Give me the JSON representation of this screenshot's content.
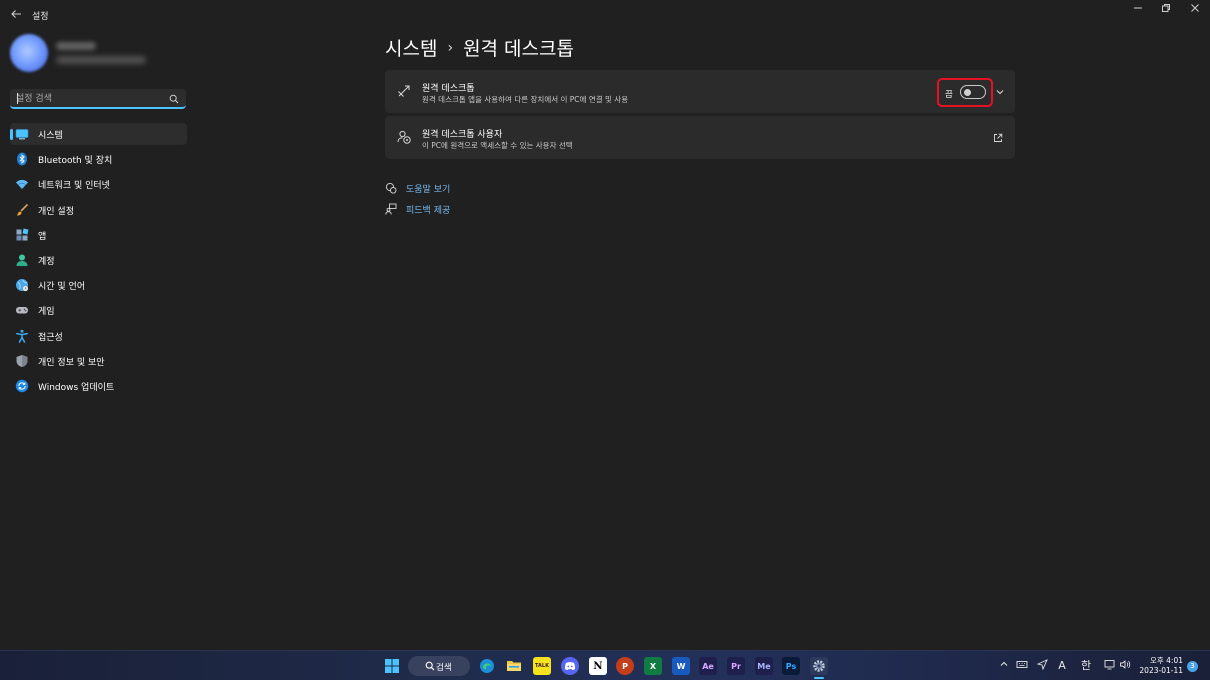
{
  "window": {
    "title": "설정",
    "controls": {
      "minimize": "—",
      "maximize": "❐",
      "close": "✕"
    }
  },
  "sidebar": {
    "search_placeholder": "설정 검색",
    "items": [
      {
        "label": "시스템",
        "icon": "system-icon",
        "active": true
      },
      {
        "label": "Bluetooth 및 장치",
        "icon": "bluetooth-icon"
      },
      {
        "label": "네트워크 및 인터넷",
        "icon": "network-icon"
      },
      {
        "label": "개인 설정",
        "icon": "personalization-brush-icon"
      },
      {
        "label": "앱",
        "icon": "apps-icon"
      },
      {
        "label": "계정",
        "icon": "account-icon"
      },
      {
        "label": "시간 및 언어",
        "icon": "time-language-icon"
      },
      {
        "label": "게임",
        "icon": "gaming-icon"
      },
      {
        "label": "접근성",
        "icon": "accessibility-icon"
      },
      {
        "label": "개인 정보 및 보안",
        "icon": "privacy-shield-icon"
      },
      {
        "label": "Windows 업데이트",
        "icon": "windows-update-icon"
      }
    ]
  },
  "main": {
    "breadcrumb": {
      "parent": "시스템",
      "separator": "›",
      "current": "원격 데스크톱"
    },
    "cards": [
      {
        "title": "원격 데스크톱",
        "subtitle": "원격 데스크톱 앱을 사용하여 다른 장치에서 이 PC에 연결 및 사용",
        "toggle_label": "끔",
        "toggle_on": false,
        "icon": "remote-desktop-icon"
      },
      {
        "title": "원격 데스크톱 사용자",
        "subtitle": "이 PC에 원격으로 액세스할 수 있는 사용자 선택",
        "icon": "remote-users-icon"
      }
    ],
    "help_links": [
      {
        "label": "도움말 보기",
        "icon": "help-icon"
      },
      {
        "label": "피드백 제공",
        "icon": "feedback-icon"
      }
    ]
  },
  "taskbar": {
    "search_label": "검색",
    "apps": [
      {
        "name": "Microsoft Edge",
        "icon": "edge-icon",
        "color": "#1d8fd6"
      },
      {
        "name": "File Explorer",
        "icon": "folder-icon",
        "color": "#f2c744"
      },
      {
        "name": "KakaoTalk",
        "icon": "kakaotalk-icon",
        "text": "TALK",
        "color": "#f7e31b"
      },
      {
        "name": "Discord",
        "icon": "discord-icon",
        "color": "#5865f2"
      },
      {
        "name": "Notion",
        "icon": "notion-icon",
        "text": "N",
        "color": "#ffffff"
      },
      {
        "name": "PowerPoint",
        "icon": "powerpoint-icon",
        "text": "P",
        "color": "#c43e1c"
      },
      {
        "name": "Excel",
        "icon": "excel-icon",
        "text": "X",
        "color": "#107c41"
      },
      {
        "name": "Word",
        "icon": "word-icon",
        "text": "W",
        "color": "#185abd"
      },
      {
        "name": "After Effects",
        "icon": "aftereffects-icon",
        "text": "Ae",
        "color": "#1f1f4d"
      },
      {
        "name": "Premiere Pro",
        "icon": "premiere-icon",
        "text": "Pr",
        "color": "#1f1f4d"
      },
      {
        "name": "Media Encoder",
        "icon": "mediaencoder-icon",
        "text": "Me",
        "color": "#1f1f4d"
      },
      {
        "name": "Photoshop",
        "icon": "photoshop-icon",
        "text": "Ps",
        "color": "#0a1b3a"
      },
      {
        "name": "Settings",
        "icon": "settings-gear-icon",
        "active": true
      }
    ],
    "tray": {
      "ime_mode": "A",
      "ime_lang": "한",
      "time": "오후 4:01",
      "date": "2023-01-11",
      "notifications": "3"
    }
  }
}
